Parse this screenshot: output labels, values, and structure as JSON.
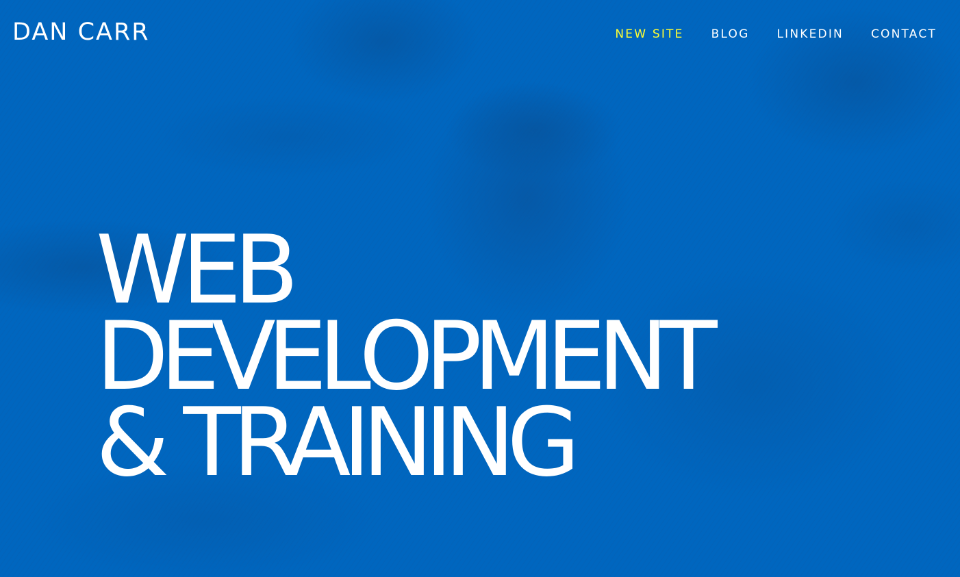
{
  "site": {
    "logo": "DAN CARR"
  },
  "nav": {
    "items": [
      {
        "label": "NEW SITE",
        "active": true
      },
      {
        "label": "BLOG",
        "active": false
      },
      {
        "label": "LINKEDIN",
        "active": false
      },
      {
        "label": "CONTACT",
        "active": false
      }
    ]
  },
  "hero": {
    "lines": [
      "WEB",
      "DEVELOPMENT",
      "& TRAINING"
    ]
  },
  "colors": {
    "background": "#0066bf",
    "text": "#ffffff",
    "active_nav": "#ffff33"
  },
  "background_image": {
    "description_icon": "portrait-photo-texture"
  }
}
